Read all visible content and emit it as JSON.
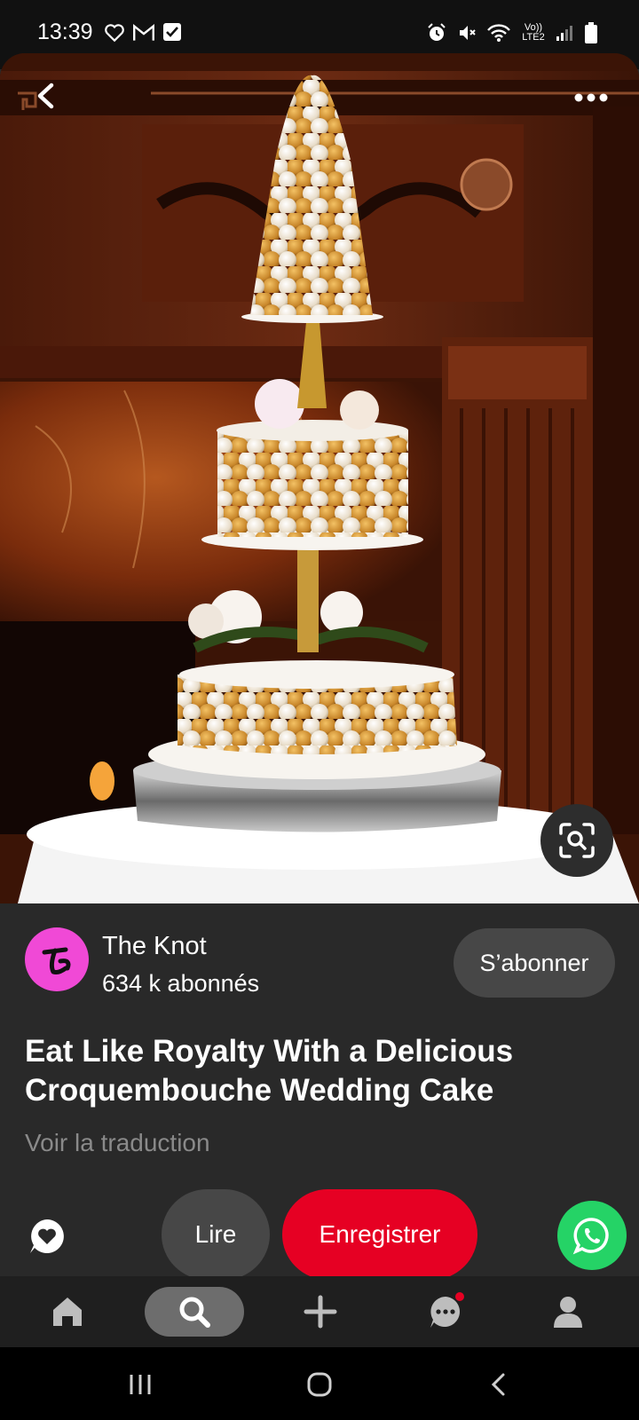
{
  "status_bar": {
    "time": "13:39",
    "left_icons": [
      "heart-icon",
      "gmail-icon",
      "check-box-icon"
    ],
    "right_icons": [
      "alarm-icon",
      "mute-icon",
      "wifi-icon",
      "lte-icon",
      "signal-icon",
      "battery-icon"
    ],
    "network_label": "Vo)) LTE2"
  },
  "pin": {
    "image_icon": "croquembouche-wedding-cake",
    "back_icon": "chevron-left-icon",
    "more_icon": "more-dots-icon",
    "lens_icon": "visual-search-icon",
    "creator": {
      "name": "The Knot",
      "followers": "634 k abonnés",
      "avatar_icon": "the-knot-logo",
      "subscribe_label": "S’abonner"
    },
    "title": "Eat Like Royalty With a Delicious Croquembouche Wedding Cake",
    "translate_label": "Voir la traduction"
  },
  "actions": {
    "comment_icon": "comment-heart-icon",
    "read_label": "Lire",
    "save_label": "Enregistrer",
    "share_icon": "whatsapp-icon"
  },
  "bottom_nav": {
    "items": [
      "home-icon",
      "search-icon",
      "plus-icon",
      "messages-icon",
      "profile-icon"
    ],
    "active": "search-icon",
    "has_notification": "messages-icon"
  },
  "system_nav": {
    "items": [
      "recent-apps-icon",
      "home-circle-icon",
      "back-icon"
    ]
  },
  "colors": {
    "save_red": "#e60023",
    "whatsapp_green": "#25d366",
    "avatar_pink": "#f049d6",
    "panel_bg": "#292929"
  }
}
